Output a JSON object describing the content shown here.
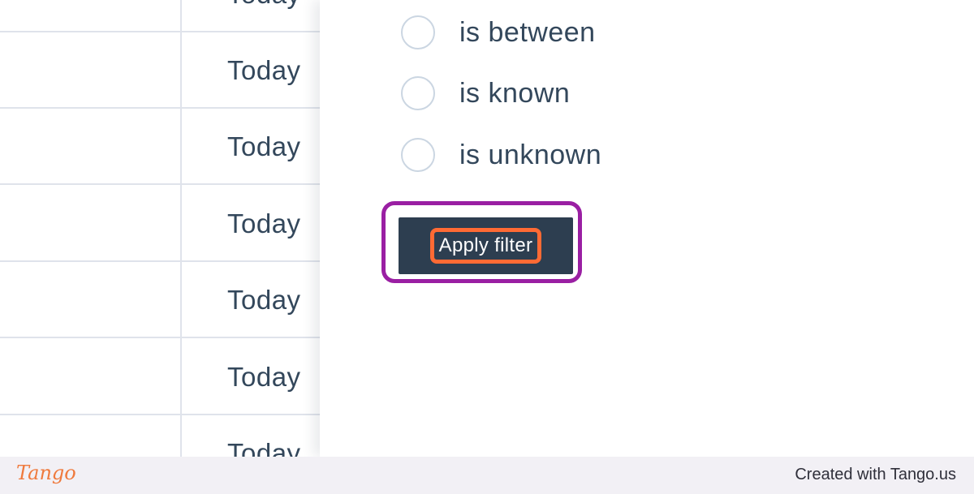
{
  "table": {
    "rows": [
      {
        "date": "Today"
      },
      {
        "date": "Today"
      },
      {
        "date": "Today"
      },
      {
        "date": "Today"
      },
      {
        "date": "Today"
      },
      {
        "date": "Today"
      },
      {
        "date": "Today"
      }
    ]
  },
  "filter": {
    "options": [
      {
        "label": "is between",
        "selected": false
      },
      {
        "label": "is known",
        "selected": false
      },
      {
        "label": "is unknown",
        "selected": false
      }
    ],
    "apply_label": "Apply filter"
  },
  "footer": {
    "logo": "Tango",
    "credit": "Created with Tango.us"
  },
  "colors": {
    "text": "#33475b",
    "button_bg": "#2d3e50",
    "highlight_outer": "#9a1fa3",
    "highlight_inner": "#ff6a34",
    "brand": "#ef7a3d"
  }
}
